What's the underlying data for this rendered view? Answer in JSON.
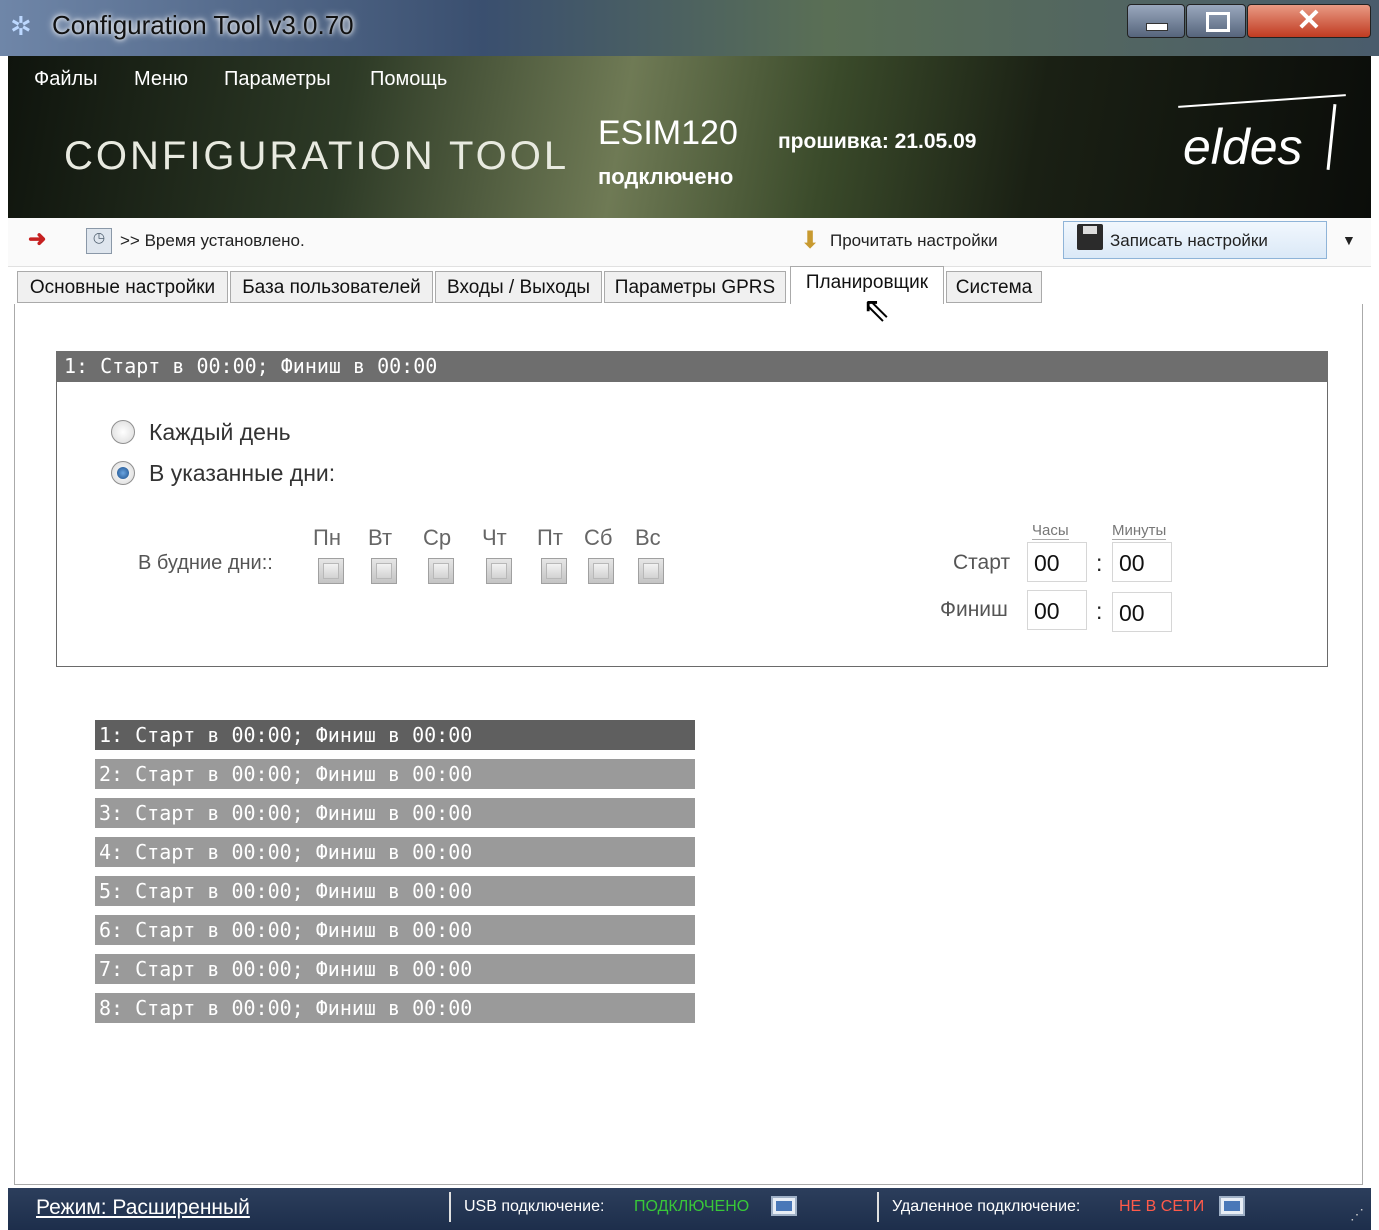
{
  "window": {
    "title": "Configuration Tool v3.0.70"
  },
  "menu": [
    "Файлы",
    "Меню",
    "Параметры",
    "Помощь"
  ],
  "header": {
    "brand": "CONFIGURATION TOOL",
    "device": "ESIM120",
    "firmware": "прошивка: 21.05.09",
    "status": "подключено",
    "logo": "eldes"
  },
  "toolbar": {
    "message": ">> Время установлено.",
    "read_label": "Прочитать настройки",
    "write_label": "Записать настройки"
  },
  "tabs": [
    "Основные настройки",
    "База пользователей",
    "Входы / Выходы",
    "Параметры GPRS",
    "Планировщик",
    "Система"
  ],
  "active_tab": "Планировщик",
  "panel": {
    "header": "1:  Старт в 00:00; Финиш в 00:00",
    "radio_every_day": "Каждый день",
    "radio_specific_days": "В указанные дни:",
    "selected_radio": "В указанные дни:",
    "weekday_label": "В будние дни::",
    "days": [
      "Пн",
      "Вт",
      "Ср",
      "Чт",
      "Пт",
      "Сб",
      "Вс"
    ],
    "days_checked": [
      false,
      false,
      false,
      false,
      false,
      false,
      false
    ],
    "hours_label": "Часы",
    "minutes_label": "Минуты",
    "start_label": "Старт",
    "finish_label": "Финиш",
    "start_hours": "00",
    "start_minutes": "00",
    "finish_hours": "00",
    "finish_minutes": "00",
    "colon": ":"
  },
  "schedules": [
    "1:  Старт в 00:00; Финиш в 00:00",
    "2:  Старт в 00:00; Финиш в 00:00",
    "3:  Старт в 00:00; Финиш в 00:00",
    "4:  Старт в 00:00; Финиш в 00:00",
    "5:  Старт в 00:00; Финиш в 00:00",
    "6:  Старт в 00:00; Финиш в 00:00",
    "7:  Старт в 00:00; Финиш в 00:00",
    "8:  Старт в 00:00; Финиш в 00:00"
  ],
  "selected_schedule": 1,
  "statusbar": {
    "mode": "Режим: Расширенный",
    "usb_label": "USB подключение:",
    "usb_value": "ПОДКЛЮЧЕНО",
    "remote_label": "Удаленное подключение:",
    "remote_value": "НЕ В СЕТИ"
  },
  "colors": {
    "selected_row": "#5f5f5f",
    "unselected_row": "#9a9a9a",
    "ok": "#38c838",
    "offline": "#ff5a4a"
  }
}
